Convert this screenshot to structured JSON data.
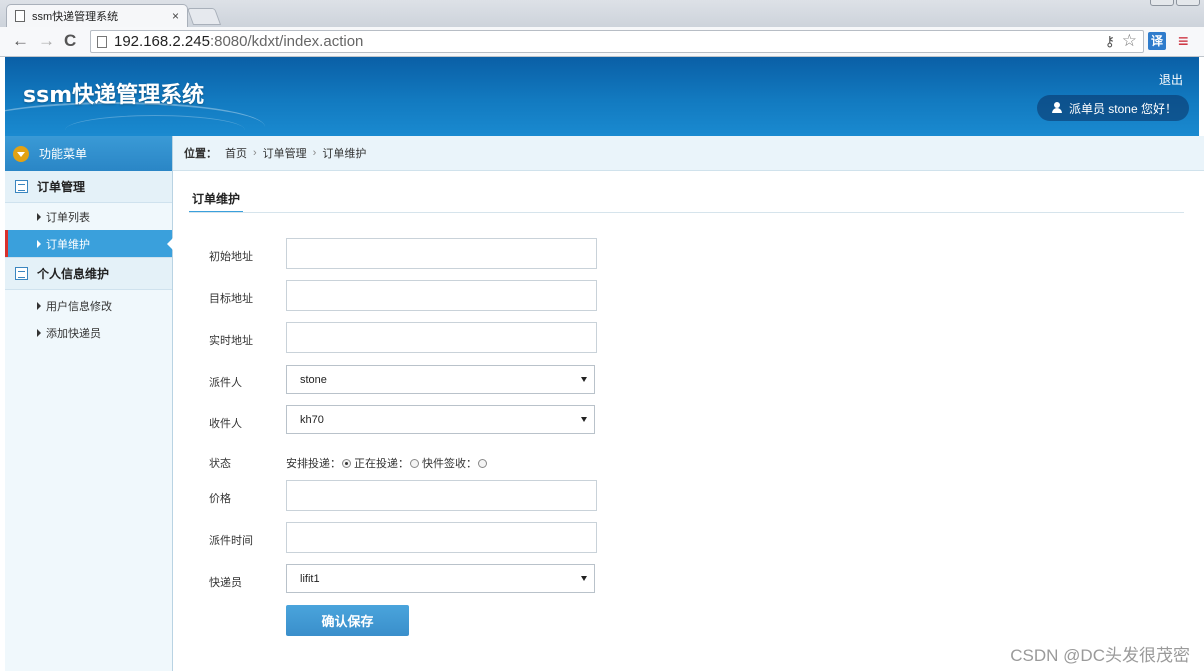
{
  "browser": {
    "tab_title": "ssm快递管理系统",
    "tab_close": "×",
    "url_host": "192.168.2.245",
    "url_path": ":8080/kdxt/index.action",
    "translate_label": "译"
  },
  "header": {
    "app_title": "ssm快递管理系统",
    "logout_label": "退出",
    "user_greeting": "派单员  stone 您好！"
  },
  "sidebar": {
    "menu_title": "功能菜单",
    "groups": [
      {
        "title": "订单管理",
        "items": [
          {
            "label": "订单列表"
          },
          {
            "label": "订单维护"
          }
        ]
      },
      {
        "title": "个人信息维护",
        "items": [
          {
            "label": "用户信息修改"
          },
          {
            "label": "添加快递员"
          }
        ]
      }
    ]
  },
  "breadcrumb": {
    "label": "位置：",
    "items": [
      "首页",
      "订单管理",
      "订单维护"
    ],
    "separator": "›"
  },
  "panel": {
    "tab_title": "订单维护"
  },
  "form": {
    "start_address_label": "初始地址",
    "start_address_value": "",
    "target_address_label": "目标地址",
    "target_address_value": "",
    "current_address_label": "实时地址",
    "current_address_value": "",
    "sender_label": "派件人",
    "sender_value": "stone",
    "receiver_label": "收件人",
    "receiver_value": "kh70",
    "status_label": "状态",
    "status_options": [
      {
        "label": "安排投递：",
        "checked": true
      },
      {
        "label": "正在投递：",
        "checked": false
      },
      {
        "label": "快件签收：",
        "checked": false
      }
    ],
    "price_label": "价格",
    "price_value": "",
    "dispatch_time_label": "派件时间",
    "dispatch_time_value": "",
    "courier_label": "快递员",
    "courier_value": "lifit1",
    "save_label": "确认保存"
  },
  "watermark": "CSDN @DC头发很茂密",
  "colors": {
    "header_blue": "#127ac0",
    "accent_blue": "#3aa0dc",
    "active_marker": "#d9302c"
  }
}
